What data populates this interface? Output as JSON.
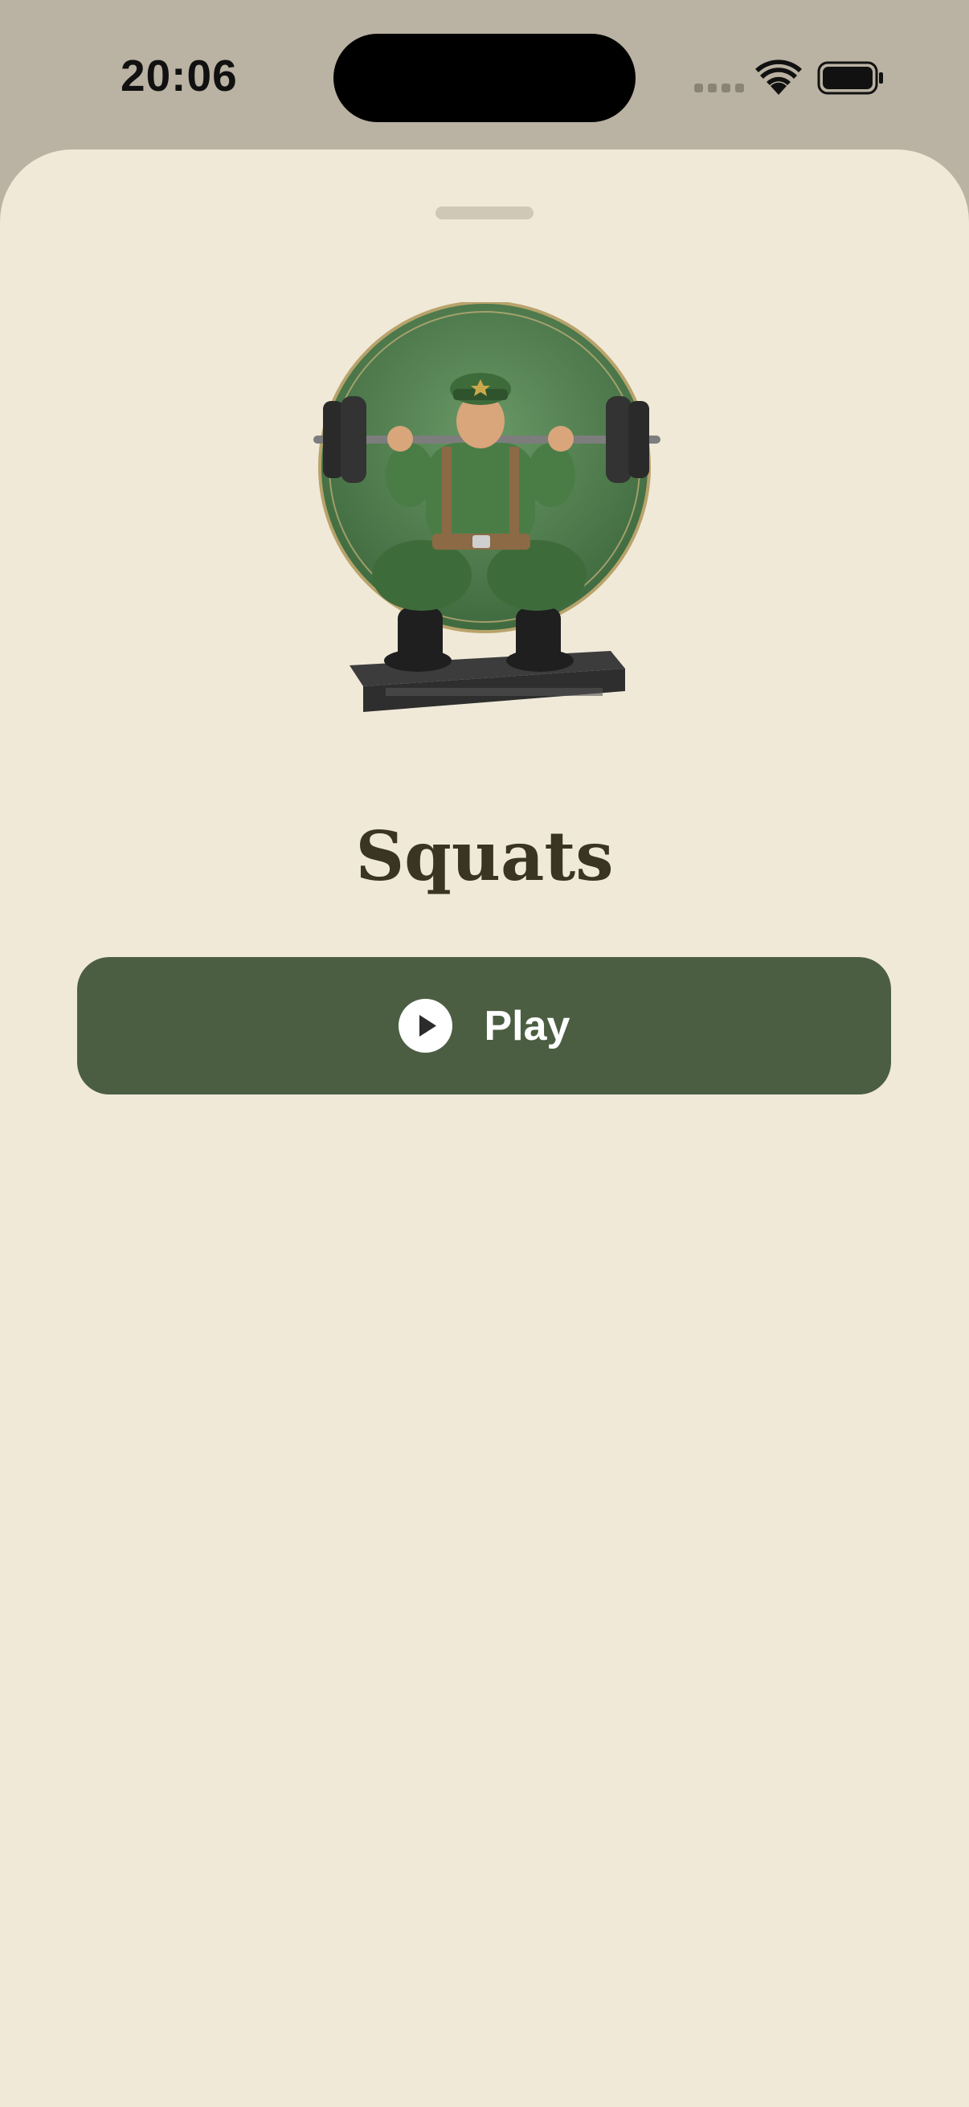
{
  "status_bar": {
    "time": "20:06",
    "icons": [
      "cellular-signal-icon",
      "wifi-icon",
      "battery-icon"
    ]
  },
  "exercise": {
    "title": "Squats",
    "illustration": "soldier-barbell-squat-illustration"
  },
  "actions": {
    "play_label": "Play",
    "play_icon": "play-circle-icon"
  },
  "colors": {
    "background": "#f0e9d8",
    "status_area": "#bab2a2",
    "button": "#4c5e42",
    "title": "#3a3523",
    "badge_green": "#5d8a57"
  }
}
